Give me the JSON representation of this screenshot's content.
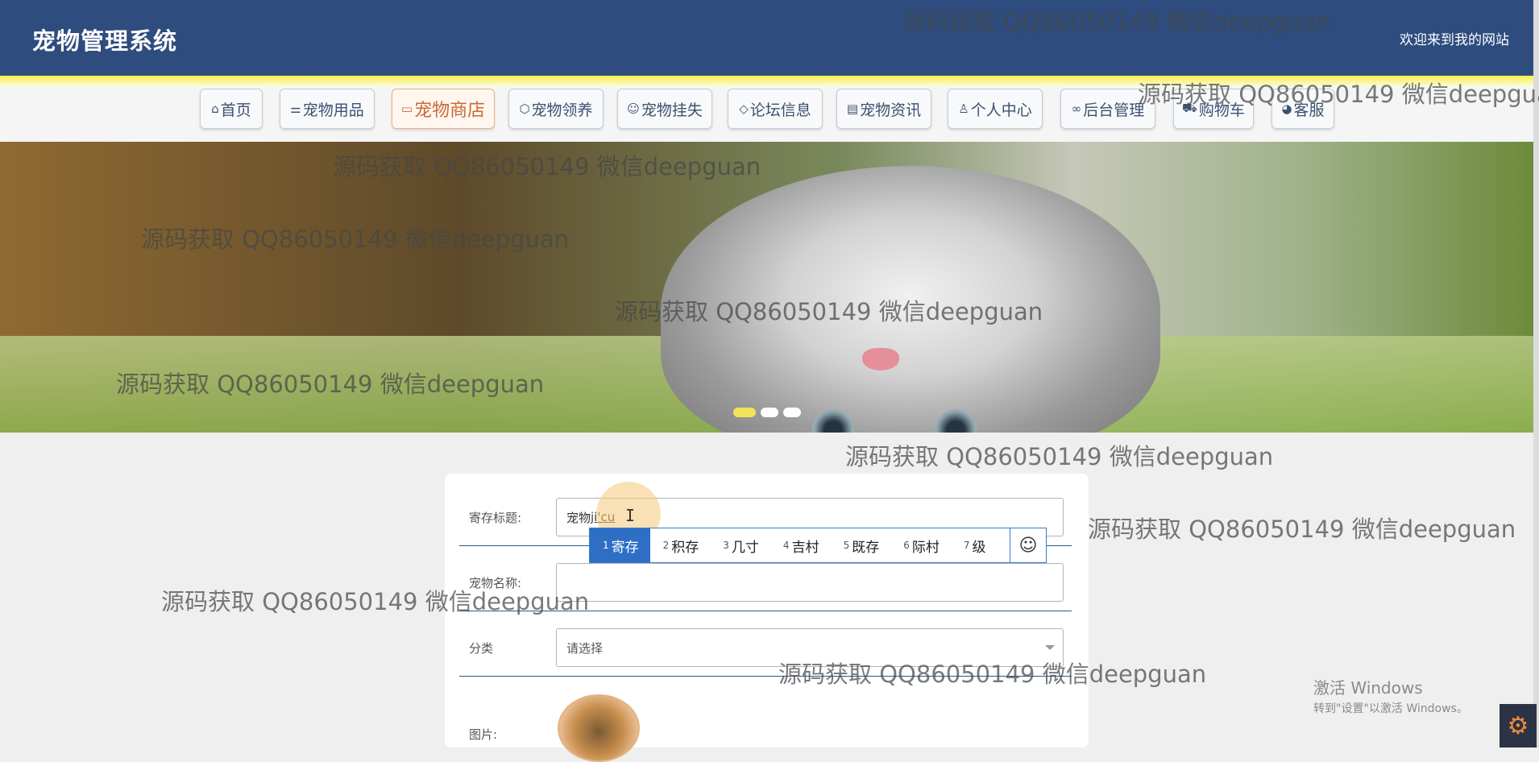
{
  "header": {
    "title": "宠物管理系统",
    "welcome": "欢迎来到我的网站"
  },
  "nav": {
    "items": [
      {
        "label": "首页",
        "icon": "home-icon",
        "glyph": "⌂"
      },
      {
        "label": "宠物用品",
        "icon": "sliders-icon",
        "glyph": "⚌"
      },
      {
        "label": "宠物商店",
        "icon": "store-icon",
        "glyph": "▭"
      },
      {
        "label": "宠物领养",
        "icon": "box-icon",
        "glyph": "⬡"
      },
      {
        "label": "宠物挂失",
        "icon": "smile-icon",
        "glyph": "☺"
      },
      {
        "label": "论坛信息",
        "icon": "tag-icon",
        "glyph": "◇"
      },
      {
        "label": "宠物资讯",
        "icon": "news-icon",
        "glyph": "▤"
      },
      {
        "label": "个人中心",
        "icon": "user-icon",
        "glyph": "♙"
      },
      {
        "label": "后台管理",
        "icon": "link-icon",
        "glyph": "∞"
      },
      {
        "label": "购物车",
        "icon": "cart-icon",
        "glyph": "⛟"
      },
      {
        "label": "客服",
        "icon": "chat-icon",
        "glyph": "◕"
      }
    ],
    "active_index": 2
  },
  "banner": {
    "active_slide": 0,
    "slide_count": 3
  },
  "form": {
    "title_label": "寄存标题:",
    "title_value_prefix": "宠物",
    "title_value_composing": "ji'cu",
    "name_label": "宠物名称:",
    "name_value": "",
    "category_label": "分类",
    "category_value": "请选择",
    "image_label": "图片:"
  },
  "ime": {
    "candidates": [
      {
        "num": "1",
        "text": "寄存"
      },
      {
        "num": "2",
        "text": "积存"
      },
      {
        "num": "3",
        "text": "几寸"
      },
      {
        "num": "4",
        "text": "吉村"
      },
      {
        "num": "5",
        "text": "既存"
      },
      {
        "num": "6",
        "text": "际村"
      },
      {
        "num": "7",
        "text": "级"
      }
    ],
    "selected_index": 0,
    "emoji_glyph": "☺"
  },
  "watermark": "源码获取 QQ86050149 微信deepguan",
  "os_notice": {
    "line1": "激活 Windows",
    "line2": "转到\"设置\"以激活 Windows。"
  }
}
